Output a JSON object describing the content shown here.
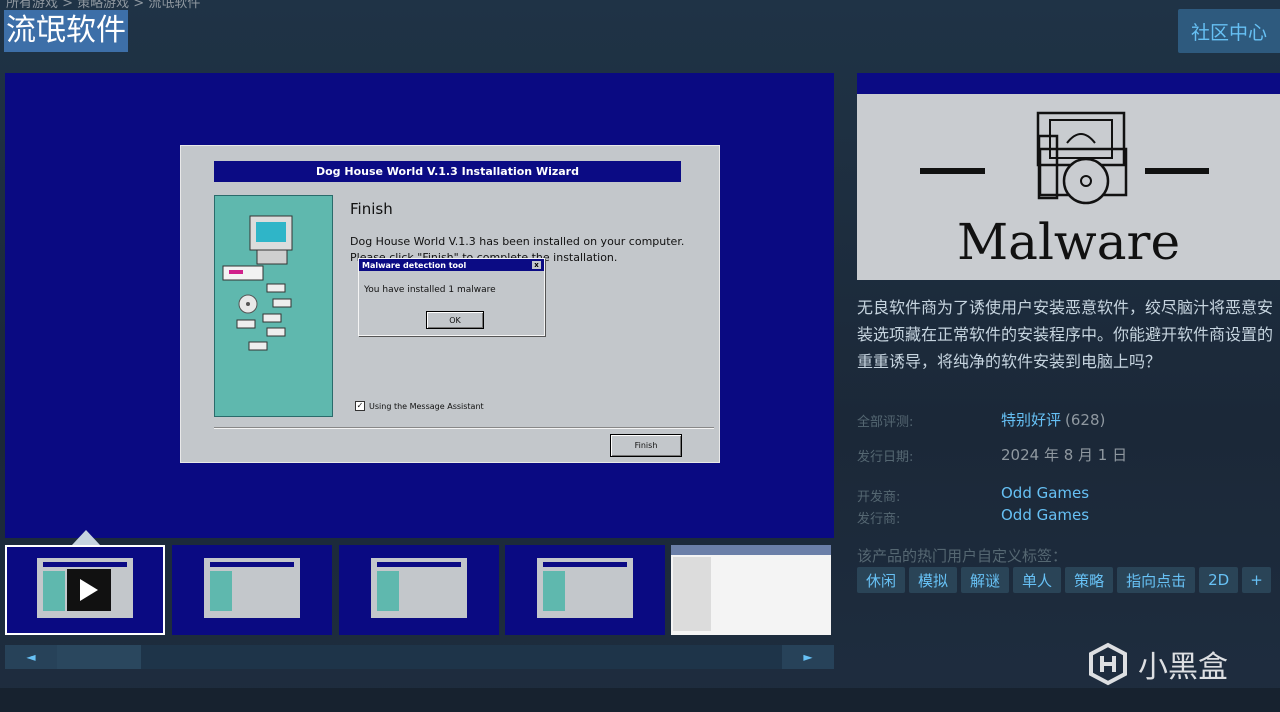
{
  "breadcrumb": "所有游戏 > 策略游戏 > 流氓软件",
  "title": "流氓软件",
  "community_hub": "社区中心",
  "screenshot": {
    "wizard_title": "Dog House World V.1.3 Installation Wizard",
    "heading": "Finish",
    "body": "Dog House World V.1.3 has been installed on your computer. Please click \"Finish\" to complete the installation.",
    "popup_title": "Malware detection tool",
    "popup_close": "x",
    "popup_message": "You have installed 1 malware",
    "popup_ok": "OK",
    "checkbox_mark": "✓",
    "checkbox_label": "Using the Message Assistant",
    "finish_button": "Finish"
  },
  "scroll": {
    "left": "◄",
    "right": "►"
  },
  "capsule_text": "Malware",
  "description": "无良软件商为了诱使用户安装恶意软件，绞尽脑汁将恶意安装选项藏在正常软件的安装程序中。你能避开软件商设置的重重诱导，将纯净的软件安装到电脑上吗？",
  "review": {
    "label": "全部评测:",
    "value": "特别好评",
    "count": "(628)"
  },
  "release": {
    "label": "发行日期:",
    "value": "2024 年 8 月 1 日"
  },
  "developer": {
    "label": "开发商:",
    "value": "Odd Games"
  },
  "publisher": {
    "label": "发行商:",
    "value": "Odd Games"
  },
  "tags_label": "该产品的热门用户自定义标签：",
  "tags": [
    "休闲",
    "模拟",
    "解谜",
    "单人",
    "策略",
    "指向点击",
    "2D"
  ],
  "tags_more": "+",
  "watermark": "小黑盒",
  "colors": {
    "accent": "#66c0f4",
    "background": "#1b2838",
    "screenshot_bg": "#0a0a82"
  }
}
